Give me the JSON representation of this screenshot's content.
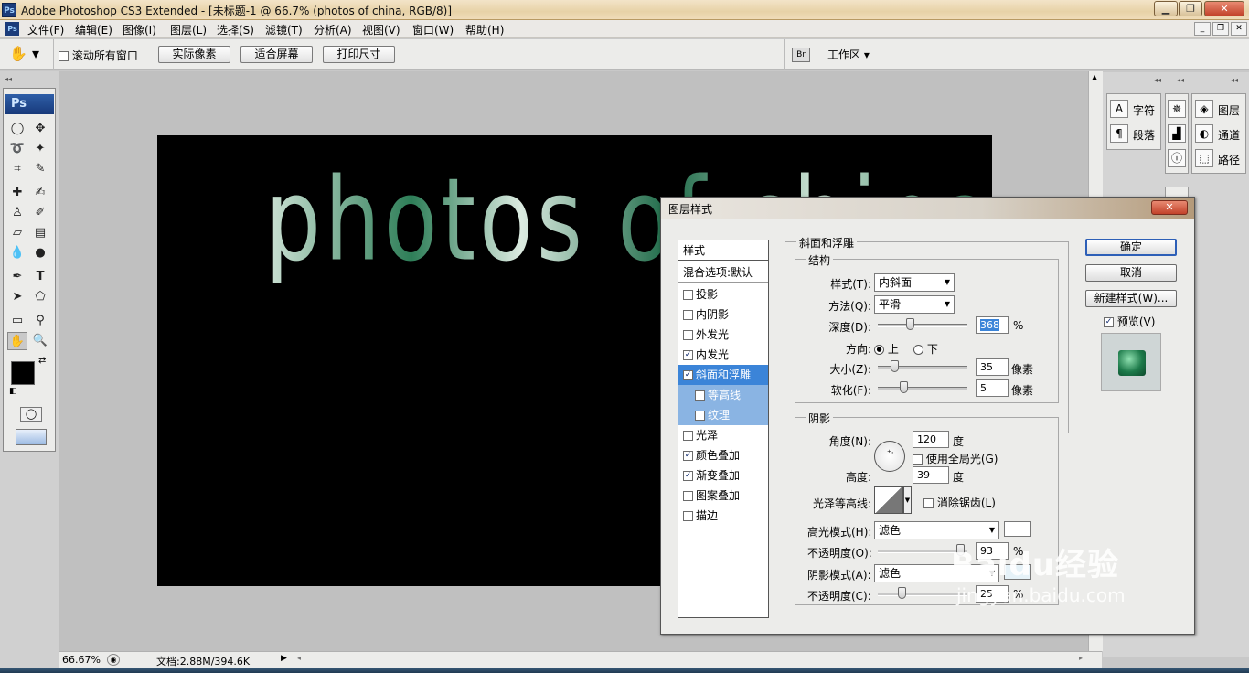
{
  "window": {
    "title": "Adobe Photoshop CS3 Extended - [未标题-1 @ 66.7% (photos  of china, RGB/8)]",
    "logo": "Ps",
    "controls": [
      "minimize-icon",
      "maximize-icon",
      "close-icon"
    ]
  },
  "menubar": {
    "items": [
      "文件(F)",
      "编辑(E)",
      "图像(I)",
      "图层(L)",
      "选择(S)",
      "滤镜(T)",
      "分析(A)",
      "视图(V)",
      "窗口(W)",
      "帮助(H)"
    ]
  },
  "options": {
    "scroll_all_label": "滚动所有窗口",
    "actual_pixels": "实际像素",
    "fit_screen": "适合屏幕",
    "print_size": "打印尺寸",
    "workspace": "工作区"
  },
  "tools": {
    "logo": "Ps"
  },
  "canvas": {
    "text": "photos  of china"
  },
  "panels": {
    "group1": [
      "字符",
      "段落"
    ],
    "group3": [
      "图层",
      "通道",
      "路径"
    ]
  },
  "dialog": {
    "title": "图层样式",
    "styles_header": "样式",
    "blend_default": "混合选项:默认",
    "style_items": [
      {
        "label": "投影",
        "checked": false
      },
      {
        "label": "内阴影",
        "checked": false
      },
      {
        "label": "外发光",
        "checked": false
      },
      {
        "label": "内发光",
        "checked": true
      },
      {
        "label": "斜面和浮雕",
        "checked": true,
        "selected": true
      },
      {
        "label": "等高线",
        "checked": false,
        "sub": true
      },
      {
        "label": "纹理",
        "checked": false,
        "sub": true
      },
      {
        "label": "光泽",
        "checked": false
      },
      {
        "label": "颜色叠加",
        "checked": true
      },
      {
        "label": "渐变叠加",
        "checked": true
      },
      {
        "label": "图案叠加",
        "checked": false
      },
      {
        "label": "描边",
        "checked": false
      }
    ],
    "bevel": {
      "section": "斜面和浮雕",
      "structure": "结构",
      "style_label": "样式(T):",
      "style_value": "内斜面",
      "technique_label": "方法(Q):",
      "technique_value": "平滑",
      "depth_label": "深度(D):",
      "depth_value": "368",
      "depth_unit": "%",
      "depth_slider": 0.35,
      "direction_label": "方向:",
      "direction_up": "上",
      "direction_down": "下",
      "size_label": "大小(Z):",
      "size_value": "35",
      "size_unit": "像素",
      "size_slider": 0.2,
      "soften_label": "软化(F):",
      "soften_value": "5",
      "soften_unit": "像素",
      "soften_slider": 0.28
    },
    "shading": {
      "section": "阴影",
      "angle_label": "角度(N):",
      "angle_value": "120",
      "angle_unit": "度",
      "global_light": "使用全局光(G)",
      "altitude_label": "高度:",
      "altitude_value": "39",
      "altitude_unit": "度",
      "gloss_label": "光泽等高线:",
      "antialias": "消除锯齿(L)",
      "highlight_label": "高光模式(H):",
      "highlight_value": "滤色",
      "highlight_opacity_label": "不透明度(O):",
      "highlight_opacity_value": "93",
      "highlight_opacity_slider": 0.93,
      "shadow_label": "阴影模式(A):",
      "shadow_value": "滤色",
      "shadow_opacity_label": "不透明度(C):",
      "shadow_opacity_value": "25",
      "shadow_opacity_slider": 0.25,
      "percent": "%"
    },
    "buttons": {
      "ok": "确定",
      "cancel": "取消",
      "new_style": "新建样式(W)...",
      "preview": "预览(V)"
    }
  },
  "status": {
    "zoom": "66.67%",
    "doc": "文档:2.88M/394.6K"
  },
  "watermark": {
    "brand": "Baidu经验",
    "url": "jingyan.baidu.com"
  },
  "colors": {
    "accent": "#3b84d8",
    "canvas_bg": "#000000",
    "text_green": "#2e7e58"
  }
}
